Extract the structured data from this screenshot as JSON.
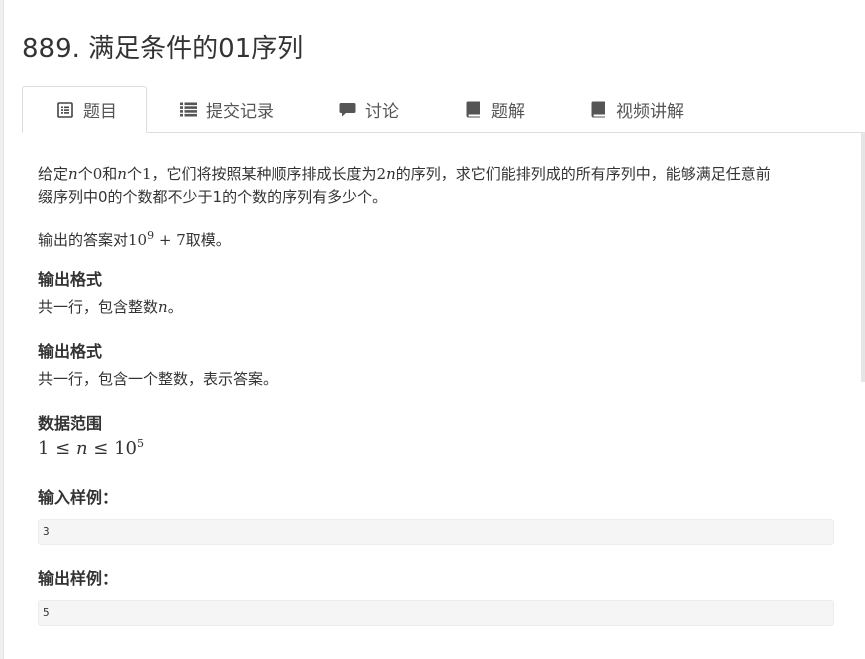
{
  "problem": {
    "title": "889. 满足条件的01序列"
  },
  "tabs": [
    {
      "label": "题目",
      "icon": "list-alt-icon",
      "active": true
    },
    {
      "label": "提交记录",
      "icon": "list-icon",
      "active": false
    },
    {
      "label": "讨论",
      "icon": "comment-icon",
      "active": false
    },
    {
      "label": "题解",
      "icon": "book-icon",
      "active": false
    },
    {
      "label": "视频讲解",
      "icon": "book-icon",
      "active": false
    }
  ],
  "description": {
    "line1_a": "给定",
    "line1_n1": "n",
    "line1_b": "个",
    "line1_0": "0",
    "line1_c": "和",
    "line1_n2": "n",
    "line1_d": "个",
    "line1_1": "1",
    "line1_e": "，它们将按照某种顺序排成长度为",
    "line1_2n_coef": "2",
    "line1_2n_var": "n",
    "line1_f": "的序列，求它们能排列成的所有序列中，能够满足任意前",
    "line2": "缀序列中0的个数都不少于1的个数的序列有多少个。",
    "mod_a": "输出的答案对",
    "mod_base": "10",
    "mod_exp": "9",
    "mod_plus": " + 7",
    "mod_b": "取模。"
  },
  "input_format": {
    "heading": "输出格式",
    "text_a": "共一行，包含整数",
    "text_var": "n",
    "text_b": "。"
  },
  "output_format": {
    "heading": "输出格式",
    "text": "共一行，包含一个整数，表示答案。"
  },
  "range": {
    "heading": "数据范围",
    "lower": "1",
    "leq1": " ≤ ",
    "var": "n",
    "leq2": " ≤ ",
    "upper_base": "10",
    "upper_exp": "5"
  },
  "sample_input": {
    "heading": "输入样例：",
    "value": "3"
  },
  "sample_output": {
    "heading": "输出样例：",
    "value": "5"
  }
}
